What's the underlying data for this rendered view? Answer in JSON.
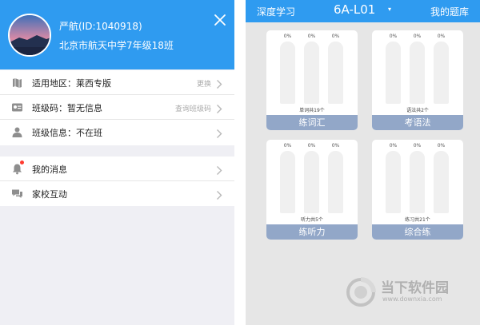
{
  "profile": {
    "name": "严航(ID:1040918)",
    "school": "北京市航天中学7年级18班"
  },
  "settings": [
    {
      "label": "适用地区：莱西专版",
      "hint": "更换",
      "icon": "map-icon"
    },
    {
      "label": "班级码：暂无信息",
      "hint": "查询班级码",
      "icon": "id-card-icon"
    },
    {
      "label": "班级信息：不在班",
      "hint": "",
      "icon": "user-icon"
    }
  ],
  "messages": [
    {
      "label": "我的消息",
      "icon": "bell-icon"
    },
    {
      "label": "家校互动",
      "icon": "chat-icon"
    }
  ],
  "topbar": {
    "left": "深度学习",
    "title": "6A-L01",
    "caret": "▾",
    "right": "我的题库"
  },
  "modules": [
    {
      "count_text": "单词共19个",
      "button": "练词汇",
      "percents": [
        "0%",
        "0%",
        "0%"
      ],
      "progress": [
        0,
        0,
        0
      ]
    },
    {
      "count_text": "语法共2个",
      "button": "考语法",
      "percents": [
        "0%",
        "0%",
        "0%"
      ],
      "progress": [
        0,
        0,
        0
      ]
    },
    {
      "count_text": "听力共5个",
      "button": "练听力",
      "percents": [
        "0%",
        "0%",
        "0%"
      ],
      "progress": [
        0,
        0,
        0
      ]
    },
    {
      "count_text": "练习共21个",
      "button": "综合练",
      "percents": [
        "0%",
        "0%",
        "0%"
      ],
      "progress": [
        0,
        0,
        0
      ]
    }
  ],
  "watermark": {
    "text": "当下软件园",
    "url": "www.downxia.com"
  },
  "colors": {
    "primary": "#2f9bf0",
    "module_button": "#92a7c8",
    "unread_dot": "#ff3b30"
  }
}
